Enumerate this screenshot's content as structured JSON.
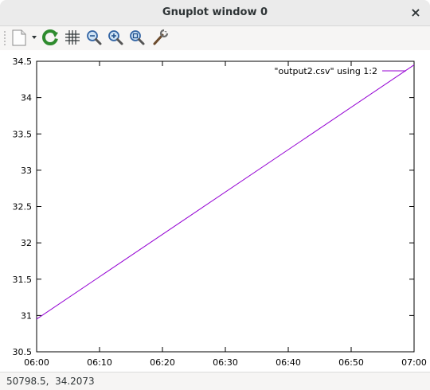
{
  "window": {
    "title": "Gnuplot window 0",
    "close_glyph": "×"
  },
  "toolbar": {
    "buttons": [
      {
        "name": "copy-to-clipboard-icon"
      },
      {
        "name": "replot-icon"
      },
      {
        "name": "grid-icon"
      },
      {
        "name": "zoom-previous-icon"
      },
      {
        "name": "zoom-next-icon"
      },
      {
        "name": "autoscale-icon"
      },
      {
        "name": "options-wrench-icon"
      }
    ]
  },
  "status": {
    "coordinates": "50798.5,  34.2073"
  },
  "chart_data": {
    "type": "line",
    "title": "",
    "xlabel": "",
    "ylabel": "",
    "x_tick_labels": [
      "06:00",
      "06:10",
      "06:20",
      "06:30",
      "06:40",
      "06:50",
      "07:00"
    ],
    "y_tick_labels": [
      "30.5",
      "31",
      "31.5",
      "32",
      "32.5",
      "33",
      "33.5",
      "34",
      "34.5"
    ],
    "xlim": [
      "06:00",
      "07:00"
    ],
    "ylim": [
      30.5,
      34.5
    ],
    "grid": false,
    "legend_position": "top-right",
    "series": [
      {
        "name": "\"output2.csv\" using 1:2",
        "color": "#9400d3",
        "points": [
          {
            "x": "06:00",
            "y": 30.95
          },
          {
            "x": "07:00",
            "y": 34.45
          }
        ]
      }
    ]
  }
}
